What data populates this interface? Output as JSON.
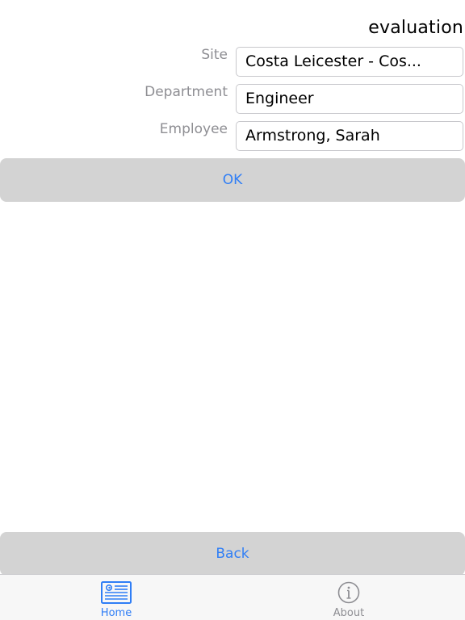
{
  "header": {
    "title": "evaluation"
  },
  "form": {
    "site": {
      "label": "Site",
      "value": "Costa Leicester - Cos..."
    },
    "department": {
      "label": "Department",
      "value": "Engineer"
    },
    "employee": {
      "label": "Employee",
      "value": "Armstrong, Sarah"
    }
  },
  "actions": {
    "ok_label": "OK",
    "back_label": "Back"
  },
  "tab_bar": {
    "items": [
      {
        "label": "Home",
        "icon": "newspaper-icon",
        "active": true
      },
      {
        "label": "About",
        "icon": "info-icon",
        "active": false
      }
    ]
  },
  "colors": {
    "accent": "#2f7ef6",
    "button_bg": "#d3d3d3",
    "label_gray": "#8e8e93"
  }
}
